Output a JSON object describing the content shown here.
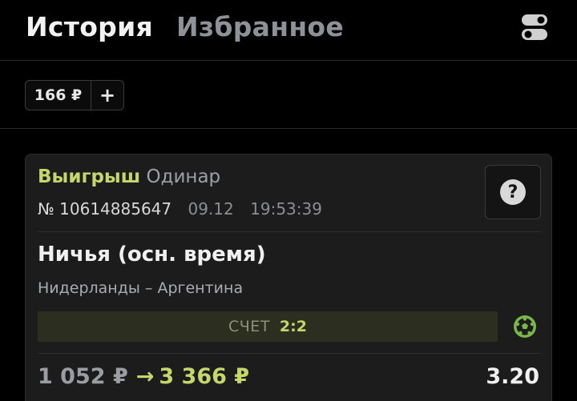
{
  "header": {
    "tabs": [
      {
        "label": "История",
        "active": true
      },
      {
        "label": "Избранное",
        "active": false
      }
    ],
    "settings_icon": "toggle-switches-icon"
  },
  "balance": {
    "amount": "166 ₽",
    "add_label": "+"
  },
  "bet": {
    "status": "Выигрыш",
    "type": "Одинар",
    "number": "№ 10614885647",
    "date": "09.12",
    "time": "19:53:39",
    "help_label": "?",
    "outcome": "Ничья (осн. время)",
    "match": "Нидерланды – Аргентина",
    "score_label": "СЧЕТ",
    "score_value": "2:2",
    "sport_icon": "soccer-ball-icon",
    "stake": "1 052 ₽",
    "arrow": "→",
    "payout": "3 366 ₽",
    "coefficient": "3.20"
  },
  "colors": {
    "accent_green": "#c5d76a",
    "background": "#000000",
    "card": "#1c1c1c",
    "soccer_icon": "#7ab648"
  }
}
